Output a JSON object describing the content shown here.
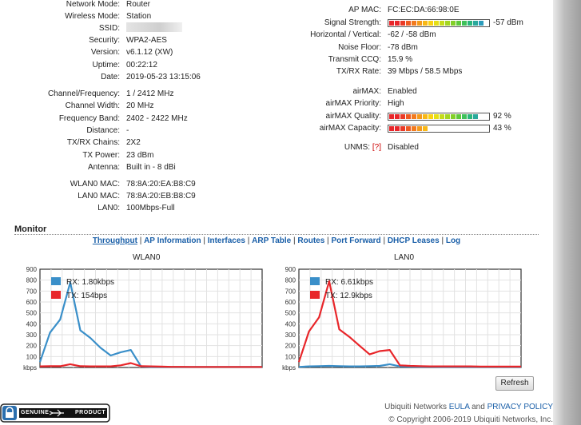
{
  "status_left": [
    {
      "label": "Network Mode:",
      "value": "Router"
    },
    {
      "label": "Wireless Mode:",
      "value": "Station"
    },
    {
      "label": "SSID:",
      "value": ""
    },
    {
      "label": "Security:",
      "value": "WPA2-AES"
    },
    {
      "label": "Version:",
      "value": "v6.1.12 (XW)"
    },
    {
      "label": "Uptime:",
      "value": "00:22:12"
    },
    {
      "label": "Date:",
      "value": "2019-05-23 13:15:06"
    },
    {
      "label": "Channel/Frequency:",
      "value": "1 / 2412 MHz"
    },
    {
      "label": "Channel Width:",
      "value": "20 MHz"
    },
    {
      "label": "Frequency Band:",
      "value": "2402 - 2422 MHz"
    },
    {
      "label": "Distance:",
      "value": "-"
    },
    {
      "label": "TX/RX Chains:",
      "value": "2X2"
    },
    {
      "label": "TX Power:",
      "value": "23 dBm"
    },
    {
      "label": "Antenna:",
      "value": "Built in - 8 dBi"
    },
    {
      "label": "WLAN0 MAC:",
      "value": "78:8A:20:EA:B8:C9"
    },
    {
      "label": "LAN0 MAC:",
      "value": "78:8A:20:EB:B8:C9"
    },
    {
      "label": "LAN0:",
      "value": "100Mbps-Full"
    }
  ],
  "status_right": {
    "ap_mac": {
      "label": "AP MAC:",
      "value": "FC:EC:DA:66:98:0E"
    },
    "signal": {
      "label": "Signal Strength:",
      "value": "-57 dBm",
      "fraction": 1.0
    },
    "hv": {
      "label": "Horizontal / Vertical:",
      "value": "-62 / -58 dBm"
    },
    "noise": {
      "label": "Noise Floor:",
      "value": "-78 dBm"
    },
    "ccq": {
      "label": "Transmit CCQ:",
      "value": "15.9 %"
    },
    "rate": {
      "label": "TX/RX Rate:",
      "value": "39 Mbps / 58.5 Mbps"
    },
    "airmax": {
      "label": "airMAX:",
      "value": "Enabled"
    },
    "priority": {
      "label": "airMAX Priority:",
      "value": "High"
    },
    "quality": {
      "label": "airMAX Quality:",
      "value": "92 %",
      "fraction": 0.92
    },
    "capacity": {
      "label": "airMAX Capacity:",
      "value": "43 %",
      "fraction": 0.43
    },
    "unms": {
      "label": "UNMS:",
      "help": "[?]",
      "value": "Disabled"
    }
  },
  "monitor": {
    "title": "Monitor",
    "tabs": [
      "Throughput",
      "AP Information",
      "Interfaces",
      "ARP Table",
      "Routes",
      "Port Forward",
      "DHCP Leases",
      "Log"
    ],
    "active_tab": "Throughput",
    "refresh_label": "Refresh"
  },
  "footer": {
    "brand": "Ubiquiti Networks",
    "eula": "EULA",
    "and": "and",
    "privacy": "PRIVACY POLICY",
    "copyright": "© Copyright 2006-2019 Ubiquiti Networks, Inc.",
    "badge_left": "GENUINE",
    "badge_right": "PRODUCT"
  },
  "colors": {
    "rx": "#3a8fc9",
    "tx": "#e8262a",
    "link": "#1a5fa8"
  },
  "chart_data": [
    {
      "type": "line",
      "title": "WLAN0",
      "ylabel": "kbps",
      "yticks": [
        0,
        100,
        200,
        300,
        400,
        500,
        600,
        700,
        800,
        900
      ],
      "ylim": [
        0,
        900
      ],
      "grid": true,
      "legend": "top-left",
      "series": [
        {
          "name": "RX: 1.80kbps",
          "color": "#3a8fc9",
          "values": [
            50,
            320,
            440,
            780,
            340,
            270,
            180,
            110,
            140,
            160,
            10,
            5,
            5,
            5,
            5,
            5,
            5,
            5,
            5,
            5,
            5,
            5,
            5
          ]
        },
        {
          "name": "TX: 154bps",
          "color": "#e8262a",
          "values": [
            10,
            12,
            12,
            30,
            12,
            10,
            10,
            10,
            20,
            40,
            12,
            10,
            8,
            6,
            6,
            5,
            5,
            5,
            5,
            5,
            5,
            5,
            5
          ]
        }
      ]
    },
    {
      "type": "line",
      "title": "LAN0",
      "ylabel": "kbps",
      "yticks": [
        0,
        100,
        200,
        300,
        400,
        500,
        600,
        700,
        800,
        900
      ],
      "ylim": [
        0,
        900
      ],
      "grid": true,
      "legend": "top-left",
      "series": [
        {
          "name": "RX: 6.61kbps",
          "color": "#3a8fc9",
          "values": [
            5,
            10,
            12,
            15,
            12,
            10,
            10,
            12,
            15,
            30,
            10,
            8,
            6,
            6,
            5,
            5,
            5,
            5,
            5,
            5,
            5,
            5,
            5
          ]
        },
        {
          "name": "TX: 12.9kbps",
          "color": "#e8262a",
          "values": [
            50,
            330,
            460,
            790,
            350,
            280,
            200,
            120,
            150,
            160,
            20,
            15,
            12,
            10,
            10,
            10,
            10,
            10,
            8,
            8,
            8,
            8,
            8
          ]
        }
      ]
    }
  ]
}
